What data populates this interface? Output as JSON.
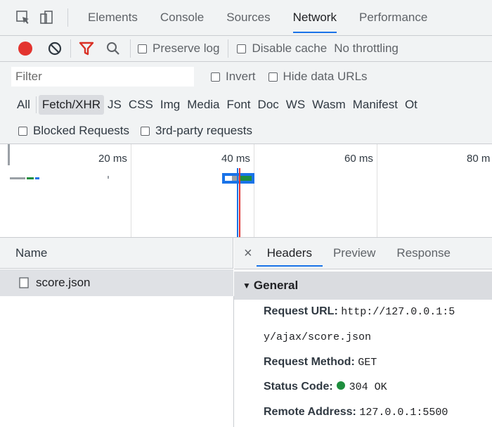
{
  "tabs": [
    {
      "label": "Elements",
      "active": false
    },
    {
      "label": "Console",
      "active": false
    },
    {
      "label": "Sources",
      "active": false
    },
    {
      "label": "Network",
      "active": true
    },
    {
      "label": "Performance",
      "active": false
    }
  ],
  "toolbar": {
    "preserve_log": "Preserve log",
    "disable_cache": "Disable cache",
    "throttling": "No throttling"
  },
  "filter": {
    "placeholder": "Filter",
    "invert": "Invert",
    "hide_data_urls": "Hide data URLs"
  },
  "types": [
    "All",
    "Fetch/XHR",
    "JS",
    "CSS",
    "Img",
    "Media",
    "Font",
    "Doc",
    "WS",
    "Wasm",
    "Manifest",
    "Ot"
  ],
  "active_type": "Fetch/XHR",
  "blocked": {
    "blocked_requests": "Blocked Requests",
    "third_party": "3rd-party requests"
  },
  "overview_ticks": [
    "20 ms",
    "40 ms",
    "60 ms",
    "80 m"
  ],
  "requests": {
    "header": "Name",
    "items": [
      "score.json"
    ]
  },
  "details": {
    "close": "×",
    "tabs": [
      "Headers",
      "Preview",
      "Response"
    ],
    "active_tab": "Headers",
    "section": "General",
    "request_url_label": "Request URL:",
    "request_url_line1": "http://127.0.0.1:5",
    "request_url_line2": "y/ajax/score.json",
    "request_method_label": "Request Method:",
    "request_method": "GET",
    "status_code_label": "Status Code:",
    "status_code": "304 OK",
    "remote_address_label": "Remote Address:",
    "remote_address": "127.0.0.1:5500"
  },
  "colors": {
    "record": "#e3342f",
    "filter_active": "#d93025",
    "accent": "#1a73e8",
    "status_ok": "#1e8e3e"
  }
}
